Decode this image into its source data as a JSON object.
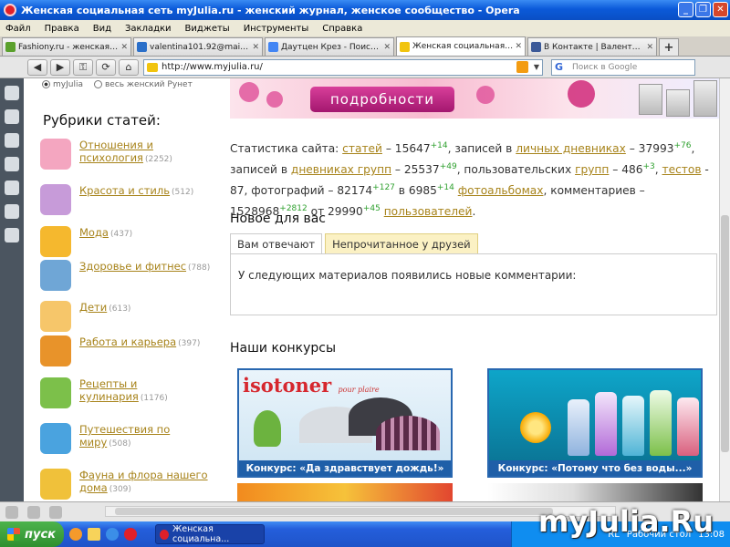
{
  "window": {
    "title": "Женская социальная сеть myJulia.ru - женский журнал, женское сообщество - Opera"
  },
  "menu": [
    "Файл",
    "Правка",
    "Вид",
    "Закладки",
    "Виджеты",
    "Инструменты",
    "Справка"
  ],
  "tabs": [
    {
      "label": "Fashiony.ru - женская м...",
      "color": "#5aa02c"
    },
    {
      "label": "valentina101.92@mail.r...",
      "color": "#2a6fc9"
    },
    {
      "label": "Даутцен Крез - Поиск ...",
      "color": "#4285f4"
    },
    {
      "label": "Женская социальная с...",
      "color": "#f1c40f"
    },
    {
      "label": "В Контакте | Валентин...",
      "color": "#3b5998"
    }
  ],
  "address": {
    "url": "http://www.myjulia.ru/",
    "search_placeholder": "Поиск в Google"
  },
  "radios": [
    "myJulia",
    "весь женский Рунет"
  ],
  "sidebar": {
    "title": "Рубрики статей:",
    "categories": [
      {
        "label": "Отношения и психология",
        "count": "(2252)",
        "color": "#f4a6c0"
      },
      {
        "label": "Красота и стиль",
        "count": "(512)",
        "color": "#c79bd9"
      },
      {
        "label": "Мода",
        "count": "(437)",
        "color": "#f5b82e"
      },
      {
        "label": "Здоровье и фитнес",
        "count": "(788)",
        "color": "#6fa6d6"
      },
      {
        "label": "Дети",
        "count": "(613)",
        "color": "#f6c66a"
      },
      {
        "label": "Работа и карьера",
        "count": "(397)",
        "color": "#e8932a"
      },
      {
        "label": "Рецепты и кулинария",
        "count": "(1176)",
        "color": "#7cc04a"
      },
      {
        "label": "Путешествия по миру",
        "count": "(508)",
        "color": "#4aa3df"
      },
      {
        "label": "Фауна и флора нашего дома",
        "count": "(309)",
        "color": "#f0c13a"
      }
    ]
  },
  "banner": {
    "button_label": "подробности"
  },
  "stats": {
    "p1": "Статистика сайта: ",
    "articles_link": "статей",
    "articles": " – 15647",
    "articles_delta": "+14",
    "p2": ", записей в ",
    "diaries_link": "личных дневниках",
    "diaries": " – 37993",
    "diaries_delta": "+76",
    "p3": ", записей в ",
    "groupdiaries_link": "дневниках групп",
    "groupdiaries": " – 25537",
    "groupdiaries_delta": "+49",
    "p4": ", пользовательских ",
    "groups_link": "групп",
    "groups": " – 486",
    "groups_delta": "+3",
    "p5": ", ",
    "tests_link": "тестов",
    "tests": " - 87, фотографий – 82174",
    "photos_delta": "+127",
    "p6": " в 6985",
    "albums_delta": "+14",
    "p7": " ",
    "albums_link": "фотоальбомах",
    "p8": ", комментариев – 1528968",
    "comments_delta": "+2812",
    "p9": " от 29990",
    "users_delta": "+45",
    "p10": " ",
    "users_link": "пользователей",
    "p11": "."
  },
  "new_for_you": {
    "title": "Новое для вас",
    "tab_replies": "Вам отвечают",
    "tab_unread": "Непрочитанное у друзей",
    "message": "У следующих материалов появились новые комментарии:"
  },
  "contests": {
    "title": "Наши конкурсы",
    "items": [
      {
        "caption": "Конкурс: «Да здравствует дождь!»",
        "brand": "isotoner",
        "brand_sub": "pour plaire"
      },
      {
        "caption": "Конкурс: «Потому что без воды...»"
      }
    ]
  },
  "taskbar": {
    "start": "пуск",
    "task": "Женская социальна...",
    "lang": "RL",
    "desktop": "Рабочий стол",
    "time": "13:08"
  },
  "watermark": "myJulia.Ru"
}
